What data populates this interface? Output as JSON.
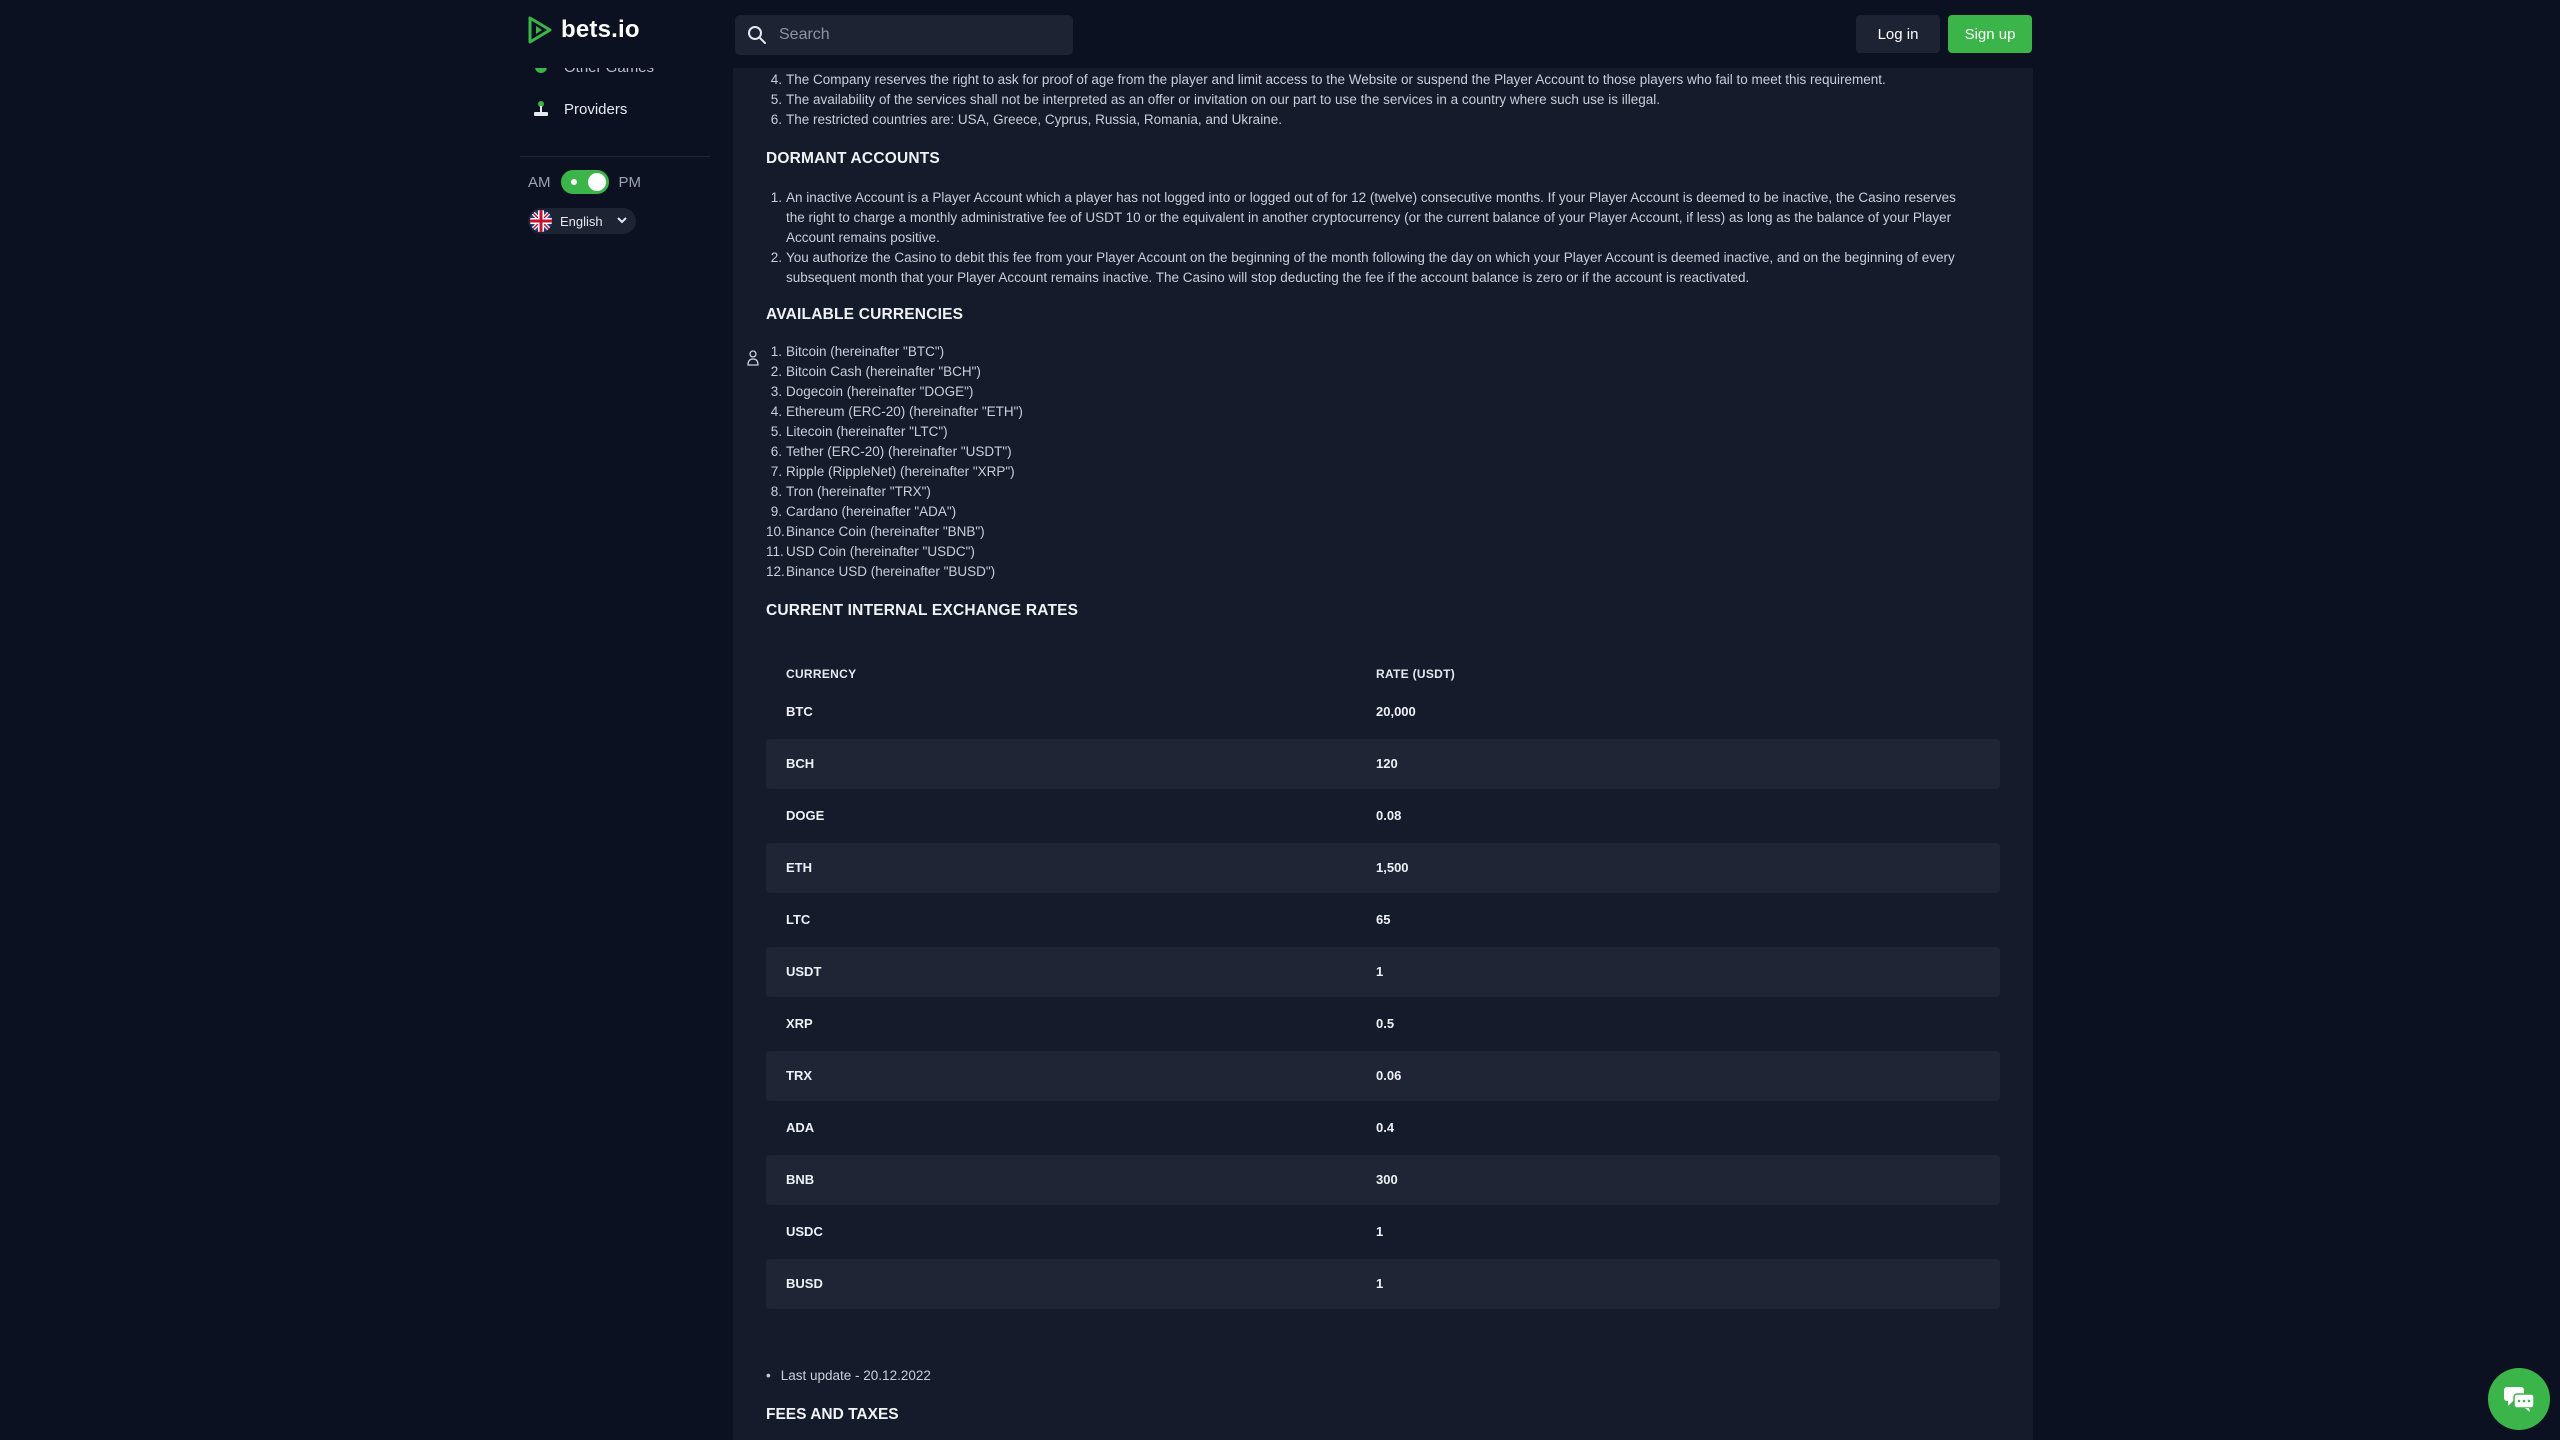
{
  "header": {
    "logo_text": "bets.io",
    "search_placeholder": "Search",
    "login_label": "Log in",
    "signup_label": "Sign up"
  },
  "sidebar": {
    "partial_item": "Other Games",
    "providers_label": "Providers",
    "am_label": "AM",
    "pm_label": "PM",
    "language": "English"
  },
  "content": {
    "top_items": [
      {
        "n": "4.",
        "text": "The Company reserves the right to ask for proof of age from the player and limit access to the Website or suspend the Player Account to those players who fail to meet this requirement."
      },
      {
        "n": "5.",
        "text": "The availability of the services shall not be interpreted as an offer or invitation on our part to use the services in a country where such use is illegal."
      },
      {
        "n": "6.",
        "text": "The restricted countries are: USA, Greece, Cyprus, Russia, Romania, and Ukraine."
      }
    ],
    "dormant_heading": "DORMANT ACCOUNTS",
    "dormant_items": [
      {
        "n": "1.",
        "text": "An inactive Account is a Player Account which a player has not logged into or logged out of for 12 (twelve) consecutive months. If your Player Account is deemed to be inactive, the Casino reserves the right to charge a monthly administrative fee of USDT 10 or the equivalent in another cryptocurrency (or the current balance of your Player Account, if less) as long as the balance of your Player Account remains positive."
      },
      {
        "n": "2.",
        "text": "You authorize the Casino to debit this fee from your Player Account on the beginning of the month following the day on which your Player Account is deemed inactive, and on the beginning of every subsequent month that your Player Account remains inactive. The Casino will stop deducting the fee if the account balance is zero or if the account is reactivated."
      }
    ],
    "currencies_heading": "AVAILABLE CURRENCIES",
    "currencies": [
      {
        "n": "1.",
        "text": "Bitcoin (hereinafter \"BTC\")"
      },
      {
        "n": "2.",
        "text": "Bitcoin Cash (hereinafter \"BCH\")"
      },
      {
        "n": "3.",
        "text": "Dogecoin (hereinafter \"DOGE\")"
      },
      {
        "n": "4.",
        "text": "Ethereum (ERC-20) (hereinafter \"ETH\")"
      },
      {
        "n": "5.",
        "text": "Litecoin (hereinafter \"LTC\")"
      },
      {
        "n": "6.",
        "text": "Tether (ERC-20) (hereinafter \"USDT\")"
      },
      {
        "n": "7.",
        "text": "Ripple (RippleNet) (hereinafter \"XRP\")"
      },
      {
        "n": "8.",
        "text": "Tron (hereinafter \"TRX\")"
      },
      {
        "n": "9.",
        "text": "Cardano (hereinafter \"ADA\")"
      },
      {
        "n": "10.",
        "text": "Binance Coin (hereinafter \"BNB\")"
      },
      {
        "n": "11.",
        "text": "USD Coin (hereinafter \"USDC\")"
      },
      {
        "n": "12.",
        "text": "Binance USD (hereinafter \"BUSD\")"
      }
    ],
    "rates_heading": "CURRENT INTERNAL EXCHANGE RATES",
    "rates_table": {
      "col_currency": "CURRENCY",
      "col_rate": "RATE (USDT)",
      "rows": [
        {
          "currency": "BTC",
          "rate": "20,000"
        },
        {
          "currency": "BCH",
          "rate": "120"
        },
        {
          "currency": "DOGE",
          "rate": "0.08"
        },
        {
          "currency": "ETH",
          "rate": "1,500"
        },
        {
          "currency": "LTC",
          "rate": "65"
        },
        {
          "currency": "USDT",
          "rate": "1"
        },
        {
          "currency": "XRP",
          "rate": "0.5"
        },
        {
          "currency": "TRX",
          "rate": "0.06"
        },
        {
          "currency": "ADA",
          "rate": "0.4"
        },
        {
          "currency": "BNB",
          "rate": "300"
        },
        {
          "currency": "USDC",
          "rate": "1"
        },
        {
          "currency": "BUSD",
          "rate": "1"
        }
      ]
    },
    "last_update": "Last update - 20.12.2022",
    "fees_heading": "FEES AND TAXES"
  },
  "colors": {
    "background": "#0b1120",
    "panel": "#141b2a",
    "accent_green": "#3bb54a"
  }
}
